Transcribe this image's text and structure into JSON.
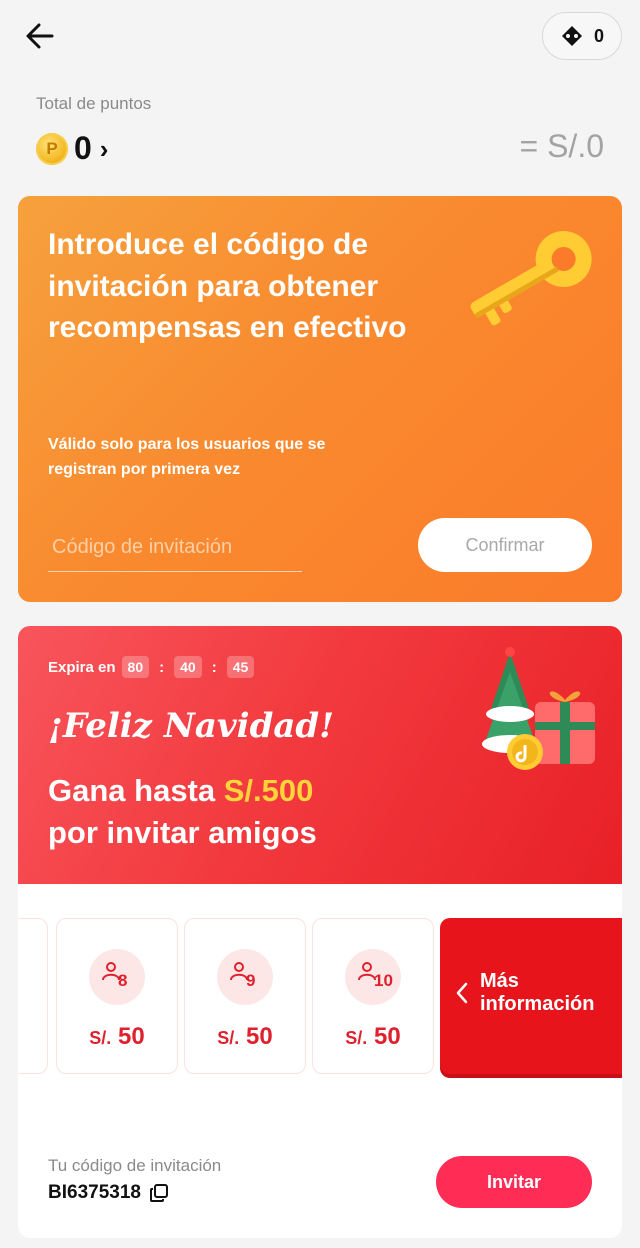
{
  "header": {
    "tickets_count": "0"
  },
  "points": {
    "label": "Total de puntos",
    "coin_letter": "P",
    "value": "0",
    "chevron": "›",
    "money": "= S/.0"
  },
  "invite_code_card": {
    "title": "Introduce el código de invitación para obtener recompensas en efectivo",
    "subtitle": "Válido solo para los usuarios que se registran por primera vez",
    "input_placeholder": "Código de invitación",
    "confirm_label": "Confirmar",
    "colors": {
      "start": "#f6a13d",
      "end": "#fb7b2a"
    }
  },
  "promo": {
    "expires_label": "Expira en",
    "timer": [
      "80",
      "40",
      "45"
    ],
    "greeting": "¡Feliz Navidad!",
    "earn_prefix": "Gana hasta ",
    "earn_amount": "S/.500",
    "earn_suffix": "por invitar amigos",
    "tiers": [
      {
        "friends": "8",
        "currency": "S/.",
        "amount": "50"
      },
      {
        "friends": "9",
        "currency": "S/.",
        "amount": "50"
      },
      {
        "friends": "10",
        "currency": "S/.",
        "amount": "50"
      }
    ],
    "more_info_label": "Más información",
    "your_code_label": "Tu código de invitación",
    "your_code": "BI6375318",
    "invite_label": "Invitar",
    "colors": {
      "accent": "#e8141c",
      "invite_button": "#ff2d55",
      "amount_highlight": "#ffd43b"
    }
  },
  "icons": [
    "back-arrow-icon",
    "ticket-icon",
    "coin-icon",
    "key-icon",
    "christmas-gift-icon",
    "user-icon",
    "chevron-left-icon",
    "copy-icon"
  ]
}
